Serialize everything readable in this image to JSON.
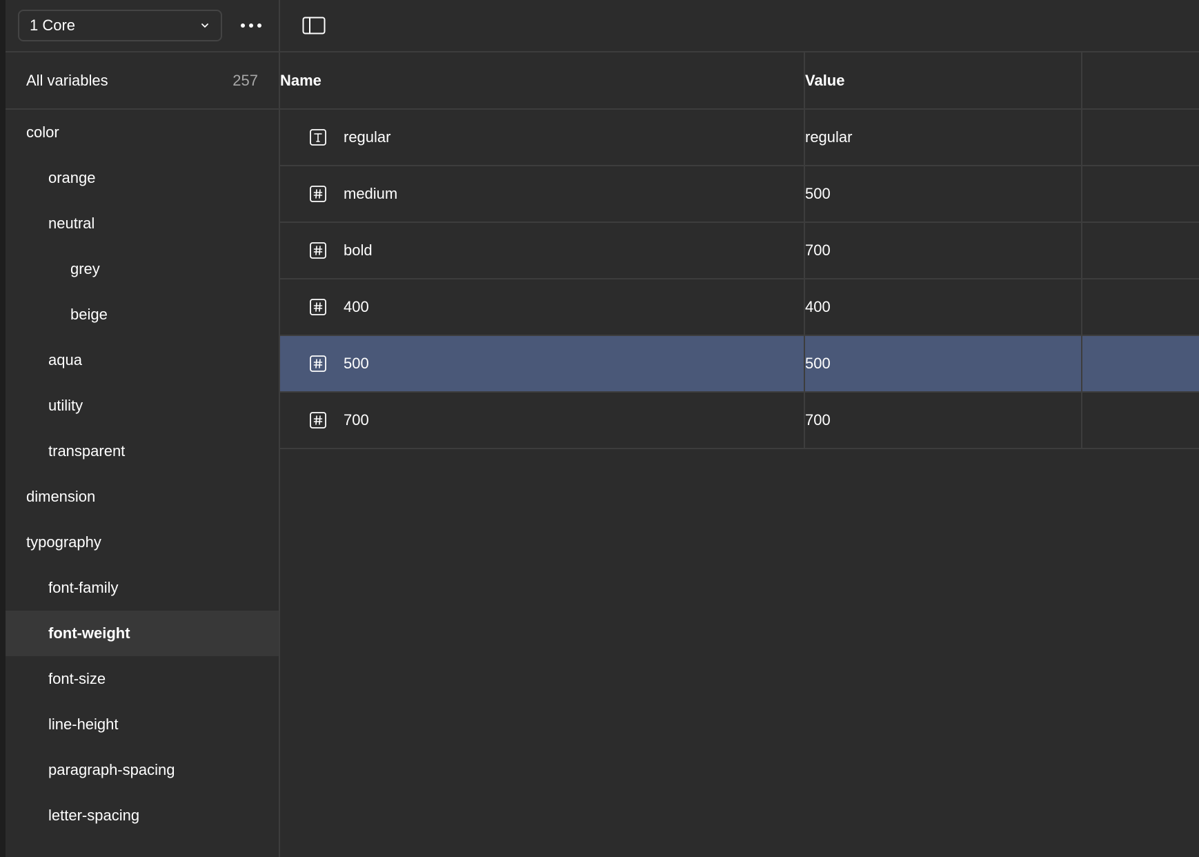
{
  "sidebar": {
    "collection": {
      "label": "1 Core"
    },
    "all_variables": {
      "label": "All variables",
      "count": "257"
    },
    "groups": [
      {
        "label": "color",
        "level": 0
      },
      {
        "label": "orange",
        "level": 1
      },
      {
        "label": "neutral",
        "level": 1
      },
      {
        "label": "grey",
        "level": 2
      },
      {
        "label": "beige",
        "level": 2
      },
      {
        "label": "aqua",
        "level": 1
      },
      {
        "label": "utility",
        "level": 1
      },
      {
        "label": "transparent",
        "level": 1
      },
      {
        "label": "dimension",
        "level": 0
      },
      {
        "label": "typography",
        "level": 0
      },
      {
        "label": "font-family",
        "level": 1
      },
      {
        "label": "font-weight",
        "level": 1,
        "selected": true
      },
      {
        "label": "font-size",
        "level": 1
      },
      {
        "label": "line-height",
        "level": 1
      },
      {
        "label": "paragraph-spacing",
        "level": 1
      },
      {
        "label": "letter-spacing",
        "level": 1
      }
    ]
  },
  "table": {
    "headers": {
      "name": "Name",
      "value": "Value"
    },
    "rows": [
      {
        "icon": "text-type-icon",
        "name": "regular",
        "value": "regular"
      },
      {
        "icon": "number-type-icon",
        "name": "medium",
        "value": "500"
      },
      {
        "icon": "number-type-icon",
        "name": "bold",
        "value": "700"
      },
      {
        "icon": "number-type-icon",
        "name": "400",
        "value": "400"
      },
      {
        "icon": "number-type-icon",
        "name": "500",
        "value": "500",
        "selected": true
      },
      {
        "icon": "number-type-icon",
        "name": "700",
        "value": "700"
      }
    ]
  },
  "colors": {
    "background": "#2c2c2c",
    "selected_row": "#4a5878",
    "selected_group": "#383838",
    "divider": "#3d3d3d"
  }
}
